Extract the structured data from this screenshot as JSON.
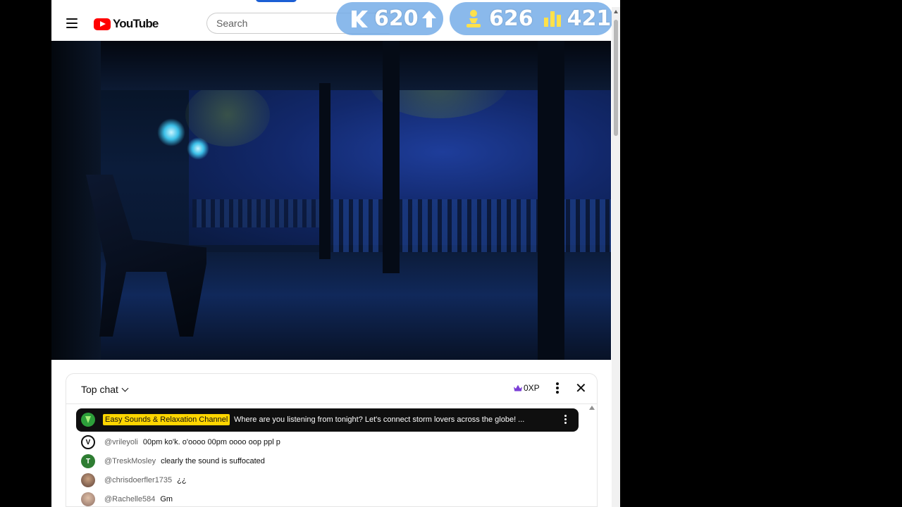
{
  "header": {
    "logo_text": "YouTube",
    "search_placeholder": "Search"
  },
  "overlay": {
    "k_value": "620",
    "pawn_value": "626",
    "bars_value": "421"
  },
  "chat": {
    "mode_label": "Top chat",
    "xp_label": "0XP",
    "pinned": {
      "author": "Easy Sounds & Relaxation Channel",
      "message": "Where are you listening from tonight? Let's connect storm lovers across the globe! ..."
    },
    "messages": [
      {
        "author": "@vrileyoli",
        "text": "00pm ko'k. o'oooo 00pm oooo oop ppl p",
        "avatar_color": "#ffffff",
        "avatar_letter": "V"
      },
      {
        "author": "@TreskMosley",
        "text": "clearly the sound is suffocated",
        "avatar_color": "#2e7d32",
        "avatar_letter": "T"
      },
      {
        "author": "@chrisdoerfler1735",
        "text": "¿¿",
        "avatar_color": "#6d4c41",
        "avatar_letter": ""
      },
      {
        "author": "@Rachelle584",
        "text": "Gm",
        "avatar_color": "#a1887f",
        "avatar_letter": ""
      }
    ]
  },
  "colors": {
    "youtube_red": "#ff0000",
    "pinned_highlight": "#ffd600",
    "overlay_badge": "#70aae6"
  }
}
